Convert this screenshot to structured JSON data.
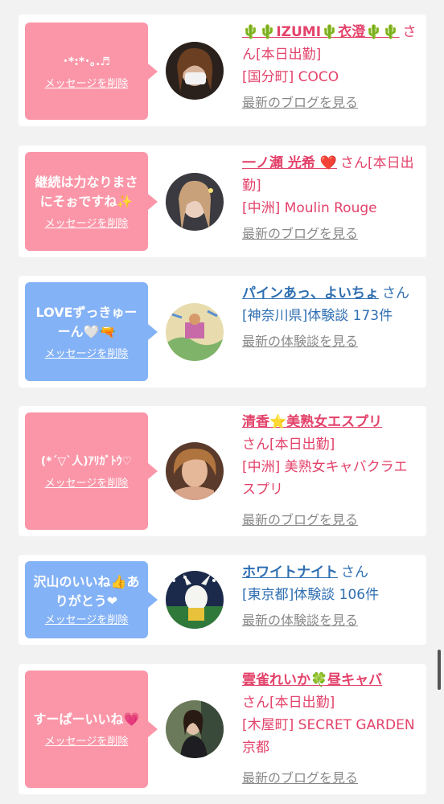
{
  "items": [
    {
      "message": "･*:*･｡.♬",
      "delete_label": "メッセージを削除",
      "name": "🌵🌵IZUMI🌵衣澄🌵🌵",
      "suffix": "さん[本日出勤]",
      "location": "[国分町] COCO",
      "link": "最新のブログを見る"
    },
    {
      "message": "継続は力なりまさにそぉですね✨",
      "delete_label": "メッセージを削除",
      "name": "一ノ瀬 光希 ❤️",
      "suffix": "さん[本日出勤]",
      "location": "[中洲] Moulin Rouge",
      "link": "最新のブログを見る"
    },
    {
      "message": "LOVEずっきゅーーん🤍🔫",
      "delete_label": "メッセージを削除",
      "name": "パインあっ、よいちょ",
      "suffix": "さん",
      "location": "[神奈川県]体験談 173件",
      "link": "最新の体験談を見る"
    },
    {
      "message": "(*´▽`人)ｱﾘｶﾞﾄｳ♡",
      "delete_label": "メッセージを削除",
      "name": "清香⭐美熟女エスプリ",
      "suffix": "さん[本日出勤]",
      "location": "[中洲] 美熟女キャバクラエスプリ",
      "link": "最新のブログを見る"
    },
    {
      "message": "沢山のいいね👍ありがとう❤",
      "delete_label": "メッセージを削除",
      "name": "ホワイトナイト",
      "suffix": "さん",
      "location": "[東京都]体験談 106件",
      "link": "最新の体験談を見る"
    },
    {
      "message": "すーぱーいいね💗",
      "delete_label": "メッセージを削除",
      "name": "雲雀れいか🍀昼キャバ",
      "suffix": "さん[本日出勤]",
      "location": "[木屋町] SECRET GARDEN 京都",
      "link": "最新のブログを見る"
    }
  ]
}
